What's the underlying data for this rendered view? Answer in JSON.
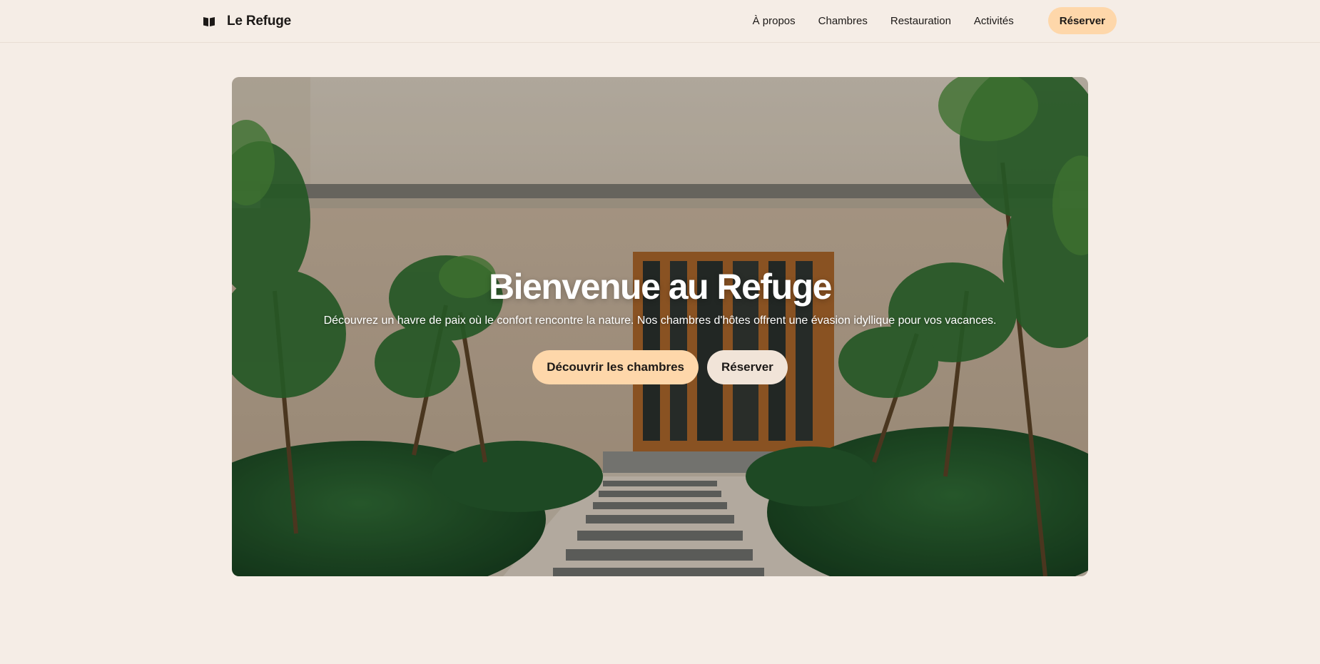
{
  "header": {
    "brand_name": "Le Refuge",
    "brand_icon": "book-icon",
    "nav": [
      "À propos",
      "Chambres",
      "Restauration",
      "Activités"
    ],
    "reserve_label": "Réserver"
  },
  "hero": {
    "title": "Bienvenue au Refuge",
    "subtitle": "Découvrez un havre de paix où le confort rencontre la nature. Nos chambres d'hôtes offrent une évasion idyllique pour vos vacances.",
    "primary_button": "Découvrir les chambres",
    "secondary_button": "Réserver"
  },
  "colors": {
    "background": "#f5ede6",
    "accent": "#fed7aa",
    "secondary_button": "#f1e4d8",
    "text": "#1c1917"
  }
}
